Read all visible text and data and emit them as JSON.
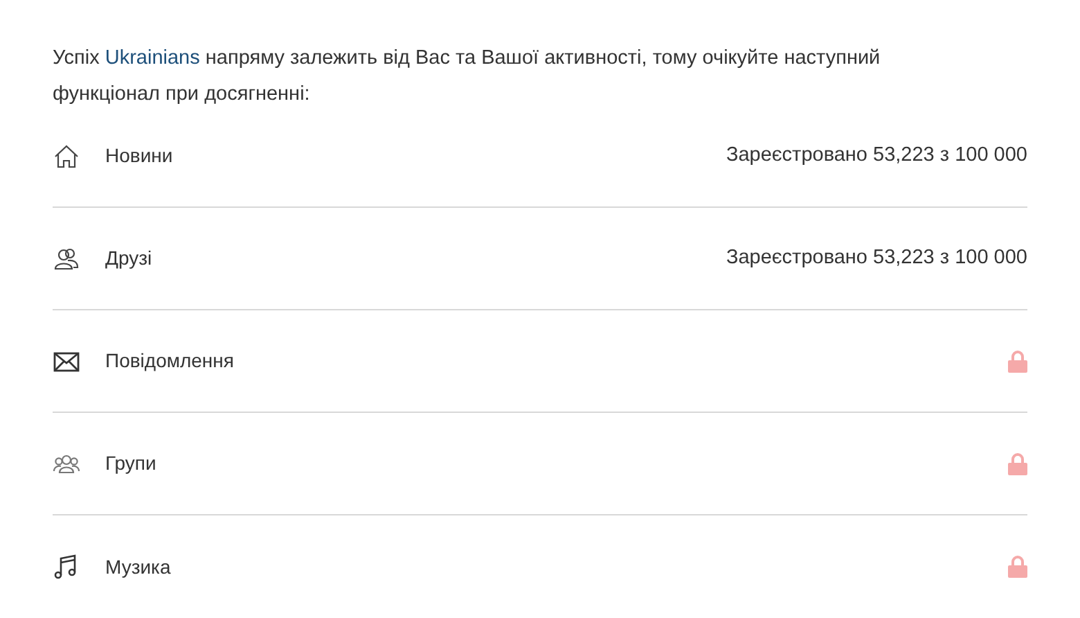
{
  "intro": {
    "text_before": "Успіх",
    "link": "Ukrainians",
    "text_after": "напряму залежить від Вас та Вашої активності, тому очікуйте наступний функціонал при досягненні:"
  },
  "features": [
    {
      "label": "Новини",
      "kind": "status",
      "status": "Зареєстровано 53,223 з 100 000"
    },
    {
      "label": "Друзі",
      "kind": "status",
      "status": "Зареєстровано 53,223 з 100 000"
    },
    {
      "label": "Повідомлення",
      "kind": "locked"
    },
    {
      "label": "Групи",
      "kind": "locked"
    },
    {
      "label": "Музика",
      "kind": "locked"
    }
  ]
}
